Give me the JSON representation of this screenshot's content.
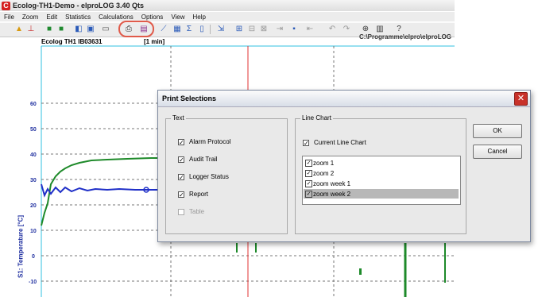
{
  "app": {
    "title": "Ecolog-TH1-Demo - elproLOG 3.40 Qts",
    "logo": "C"
  },
  "menu": [
    "File",
    "Zoom",
    "Edit",
    "Statistics",
    "Calculations",
    "Options",
    "View",
    "Help"
  ],
  "chart_header": {
    "logger": "Ecolog TH1 IB03631",
    "interval": "[1 min]",
    "path": "C:\\Programme\\elpro\\elproLOG"
  },
  "chart": {
    "ylabel": "S1: Temperature [°C]",
    "yticks": [
      "60",
      "50",
      "40",
      "30",
      "20",
      "10",
      "0",
      "-10"
    ]
  },
  "dialog": {
    "title": "Print Selections",
    "text_group": {
      "label": "Text",
      "items": [
        {
          "label": "Alarm Protocol",
          "checked": true,
          "disabled": false
        },
        {
          "label": "Audit Trail",
          "checked": true,
          "disabled": false
        },
        {
          "label": "Logger Status",
          "checked": true,
          "disabled": false
        },
        {
          "label": "Report",
          "checked": true,
          "disabled": false
        },
        {
          "label": "Table",
          "checked": false,
          "disabled": true
        }
      ]
    },
    "line_group": {
      "label": "Line Chart",
      "current": {
        "label": "Current Line Chart",
        "checked": true
      },
      "list": [
        {
          "label": "zoom 1",
          "checked": true,
          "selected": false
        },
        {
          "label": "zoom 2",
          "checked": true,
          "selected": false
        },
        {
          "label": "zoom week 1",
          "checked": true,
          "selected": false
        },
        {
          "label": "zoom week 2",
          "checked": true,
          "selected": true
        }
      ]
    },
    "ok_label": "OK",
    "cancel_label": "Cancel",
    "check_glyph": "✓"
  },
  "colors": {
    "accent": "#d42020",
    "highlight": "#e05a4a",
    "series_blue": "#2030c8",
    "series_green": "#1e8a2a",
    "grid_red": "#e03030",
    "grid_cyan": "#30c0e0"
  },
  "icons": {
    "close": "close-icon",
    "print": "print-icon",
    "print-preview": "print-preview-icon"
  }
}
